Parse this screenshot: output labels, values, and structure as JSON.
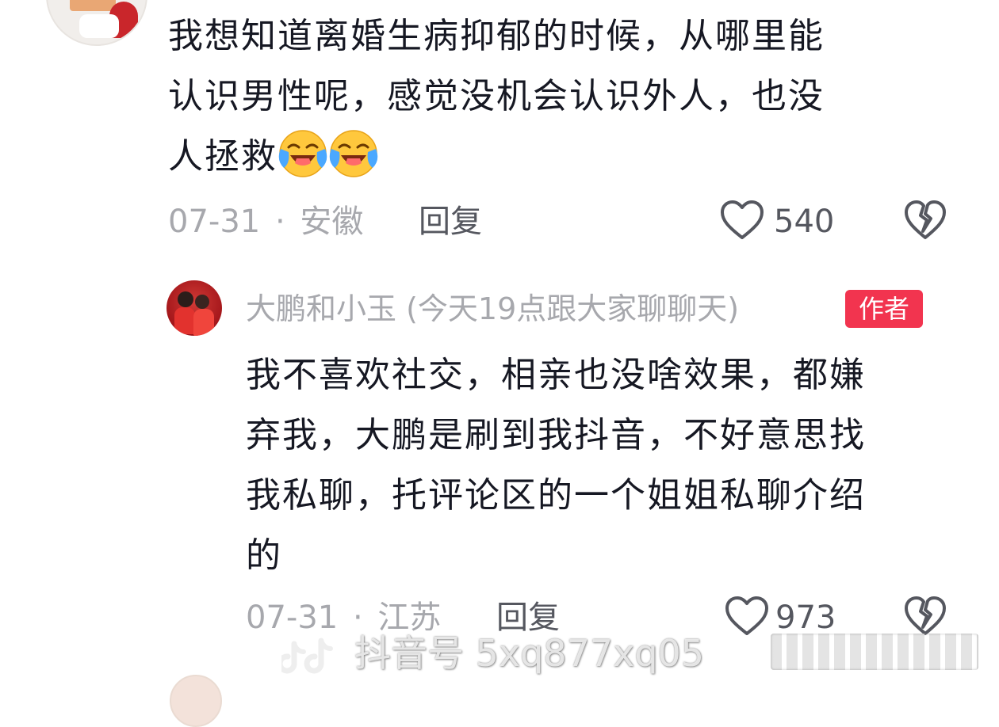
{
  "comment1": {
    "lines": [
      "我想知道离婚生病抑郁的时候，从哪里能",
      "认识男性呢，感觉没机会认识外人，也没",
      "人拯救"
    ],
    "emojis": [
      "crying-laughing-emoji",
      "crying-laughing-emoji"
    ],
    "date": "07-31",
    "separator": "·",
    "location": "安徽",
    "reply_label": "回复",
    "likes": "540"
  },
  "comment2": {
    "author_name": "大鹏和小玉 (今天19点跟大家聊聊天)",
    "author_badge": "作者",
    "lines": [
      "我不喜欢社交，相亲也没啥效果，都嫌",
      "弃我，大鹏是刷到我抖音，不好意思找",
      "我私聊，托评论区的一个姐姐私聊介绍",
      "的"
    ],
    "date": "07-31",
    "separator": "·",
    "location": "江苏",
    "reply_label": "回复",
    "likes": "973"
  },
  "watermark": {
    "text": "抖音号 5xq877xq05"
  },
  "icons": {
    "like": "heart-outline-icon",
    "dislike": "broken-heart-icon",
    "emoji": "crying-laughing-emoji"
  },
  "colors": {
    "text_primary": "#161823",
    "text_meta": "#a7a8ad",
    "text_action": "#55575f",
    "author_badge": "#f2344f"
  }
}
